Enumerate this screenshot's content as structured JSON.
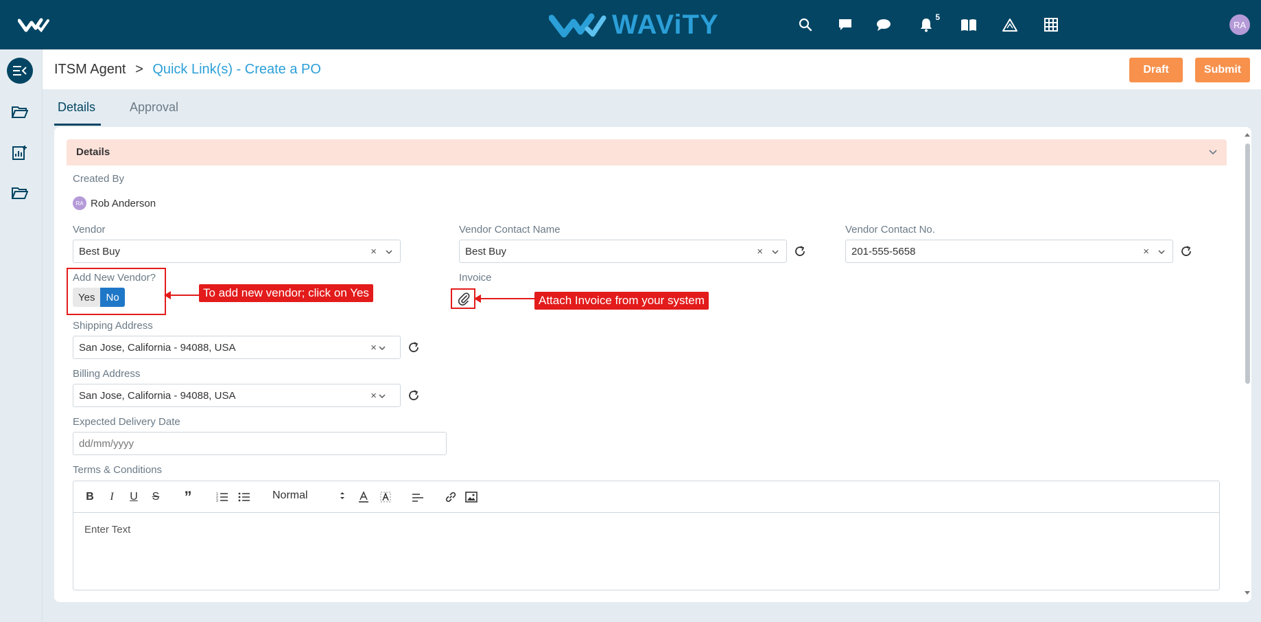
{
  "topbar": {
    "brand": "WAViTY",
    "notification_count": "5",
    "user_initials": "RA",
    "icons": [
      "search-icon",
      "chat-square-icon",
      "chat-bubble-icon",
      "bell-icon",
      "book-icon",
      "warning-icon",
      "grid-icon"
    ]
  },
  "sidebar": {
    "items": [
      "menu-collapse-icon",
      "folder-icon",
      "report-icon",
      "folder-icon"
    ]
  },
  "header": {
    "crumb_root": "ITSM Agent",
    "crumb_sep": ">",
    "crumb_current": "Quick Link(s) - Create a PO",
    "draft_label": "Draft",
    "submit_label": "Submit"
  },
  "tabs": [
    {
      "label": "Details",
      "active": true
    },
    {
      "label": "Approval",
      "active": false
    }
  ],
  "form": {
    "section_title": "Details",
    "created_by_label": "Created By",
    "created_by_initials": "RA",
    "created_by_name": "Rob Anderson",
    "vendor_label": "Vendor",
    "vendor_value": "Best Buy",
    "vendor_contact_name_label": "Vendor Contact Name",
    "vendor_contact_name_value": "Best Buy",
    "vendor_contact_no_label": "Vendor Contact No.",
    "vendor_contact_no_value": "201-555-5658",
    "add_new_vendor_label": "Add New Vendor?",
    "add_new_vendor_yes": "Yes",
    "add_new_vendor_no": "No",
    "add_new_vendor_selected": "No",
    "invoice_label": "Invoice",
    "shipping_address_label": "Shipping Address",
    "shipping_address_value": "San Jose, California - 94088, USA",
    "billing_address_label": "Billing Address",
    "billing_address_value": "San Jose, California - 94088, USA",
    "expected_delivery_label": "Expected Delivery Date",
    "expected_delivery_placeholder": "dd/mm/yyyy",
    "terms_label": "Terms & Conditions",
    "editor_format": "Normal",
    "editor_placeholder": "Enter Text",
    "clear_symbol": "×"
  },
  "annotations": {
    "vendor_callout": "To add new vendor; click on Yes",
    "invoice_callout": "Attach Invoice from your system",
    "highlight_color": "#e31b1b"
  },
  "colors": {
    "topbar": "#034563",
    "accent_orange": "#f7914c",
    "section_header": "#fde2da",
    "toggle_active": "#1f77c7",
    "link": "#2b9fd8"
  }
}
